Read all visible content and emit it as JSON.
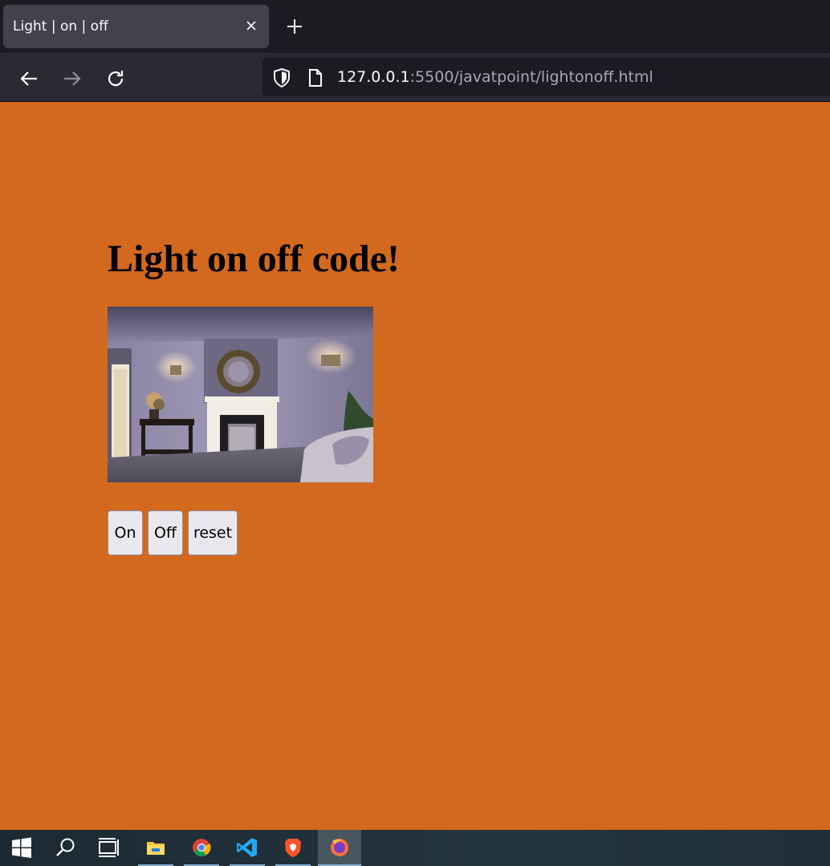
{
  "browser": {
    "tab_title": "Light | on | off",
    "url_host": "127.0.0.1",
    "url_rest": ":5500/javatpoint/lightonoff.html"
  },
  "page": {
    "background_color": "#d2691e",
    "heading": "Light on off code!",
    "image_description_icon": "room-photo",
    "buttons": {
      "on": "On",
      "off": "Off",
      "reset": "reset"
    }
  },
  "taskbar": {
    "items": [
      "windows-start-icon",
      "search-icon",
      "task-view-icon",
      "file-explorer-icon",
      "chrome-icon",
      "vscode-icon",
      "brave-icon",
      "firefox-icon"
    ]
  }
}
